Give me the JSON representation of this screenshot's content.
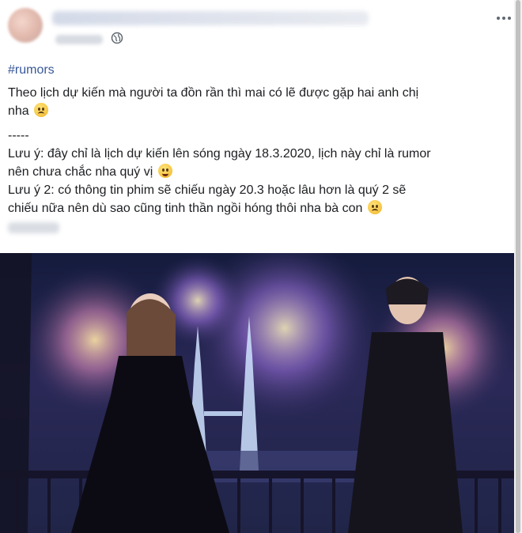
{
  "post": {
    "hashtag": "#rumors",
    "line1": "Theo lịch dự kiến mà người ta đồn rần thì mai có lẽ được gặp hai anh chị",
    "line1b": "nha",
    "separator": "-----",
    "note1a": "Lưu ý: đây chỉ là lịch dự kiến lên sóng ngày 18.3.2020, lịch này chỉ là rumor",
    "note1b": "nên chưa chắc nha quý vị",
    "note2a": "Lưu ý 2: có thông tin phim sẽ chiếu ngày 20.3 hoặc lâu hơn là quý 2 sẽ",
    "note2b": "chiếu nữa nên dù sao cũng tinh thần ngồi hóng thôi nha bà con"
  },
  "icons": {
    "globe": "globe-icon",
    "more": "more-options-icon",
    "sad_emoji": "sad-face-emoji",
    "laugh_emoji": "rofl-emoji"
  },
  "colors": {
    "link": "#385898",
    "text": "#1c1e21",
    "secondary": "#606770"
  }
}
